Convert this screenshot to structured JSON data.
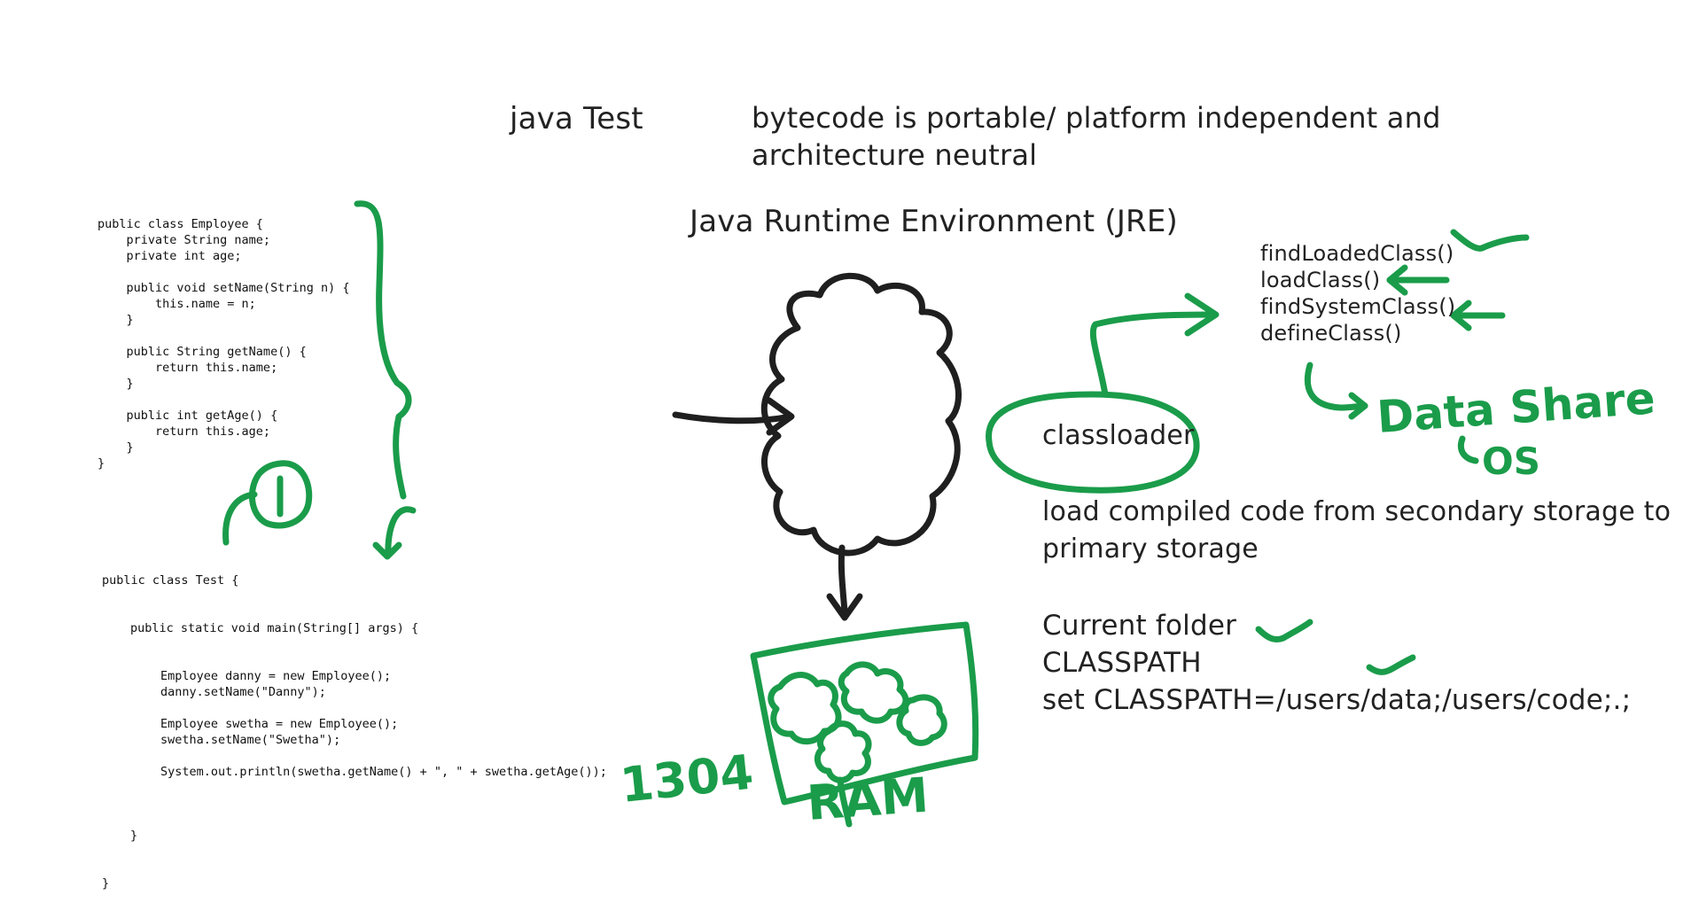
{
  "whiteboard": {
    "command": "java Test",
    "bytecode_note": {
      "line1": "bytecode is portable/ platform independent and",
      "line2": "architecture neutral"
    },
    "jre_heading": "Java Runtime Environment (JRE)",
    "classloader_methods": [
      "findLoadedClass()",
      "loadClass()",
      "findSystemClass()",
      "defineClass()"
    ],
    "classloader_label": "classloader",
    "load_description": {
      "line1": "load compiled code from secondary storage to",
      "line2": "primary storage"
    },
    "classpath_notes": {
      "line1": "Current folder",
      "line2": "CLASSPATH",
      "line3": "set CLASSPATH=/users/data;/users/code;.;"
    }
  },
  "employee_code": [
    "public class Employee {",
    "    private String name;",
    "    private int age;",
    "",
    "    public void setName(String n) {",
    "        this.name = n;",
    "    }",
    "",
    "    public String getName() {",
    "        return this.name;",
    "    }",
    "",
    "    public int getAge() {",
    "        return this.age;",
    "    }",
    "}"
  ],
  "test_code": {
    "class_decl": "public class Test {",
    "main_decl": "public static void main(String[] args) {",
    "statements": [
      "Employee danny = new Employee();",
      "danny.setName(\"Danny\");",
      "",
      "Employee swetha = new Employee();",
      "swetha.setName(\"Swetha\");",
      "",
      "System.out.println(swetha.getName() + \", \" + swetha.getAge());",
      ""
    ],
    "main_close": "}",
    "class_close": "}"
  },
  "annotations": {
    "ink_color": "#1a9c4a",
    "pen_color": "#1f1f1f",
    "data_share_scribble": "Data Share",
    "os_scribble": "OS",
    "number_scribble": "1304",
    "ram_scribble": "RAM",
    "circled_number": "1"
  }
}
